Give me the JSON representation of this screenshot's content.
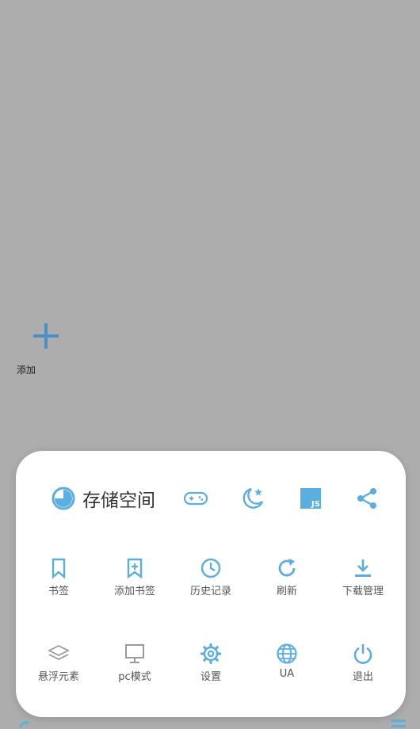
{
  "canvas": {
    "add_label": "添加"
  },
  "menu": {
    "storage_label": "存储空间",
    "top_icons": [
      "gamepad-icon",
      "night-mode-icon",
      "javascript-icon",
      "share-icon"
    ],
    "js_badge": "JS",
    "row1": [
      {
        "icon": "bookmark-icon",
        "label": "书签"
      },
      {
        "icon": "add-bookmark-icon",
        "label": "添加书签"
      },
      {
        "icon": "history-icon",
        "label": "历史记录"
      },
      {
        "icon": "refresh-icon",
        "label": "刷新"
      },
      {
        "icon": "download-icon",
        "label": "下载管理"
      }
    ],
    "row2": [
      {
        "icon": "layers-icon",
        "label": "悬浮元素"
      },
      {
        "icon": "monitor-icon",
        "label": "pc模式"
      },
      {
        "icon": "settings-icon",
        "label": "设置"
      },
      {
        "icon": "globe-icon",
        "label": "UA"
      },
      {
        "icon": "power-icon",
        "label": "退出"
      }
    ]
  },
  "colors": {
    "accent": "#5aaee0",
    "gray_icon": "#9a9a9a",
    "background": "#adadad"
  }
}
